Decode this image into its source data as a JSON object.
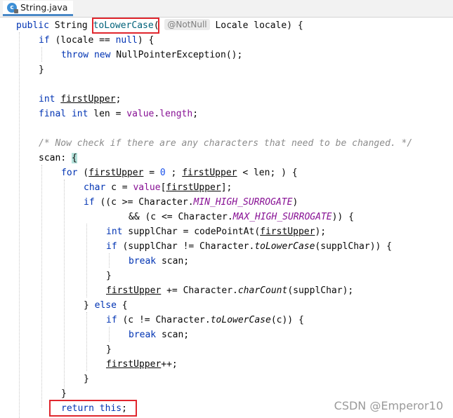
{
  "tab": {
    "title": "String.java",
    "icon": "java-class-icon",
    "icon_letter": "c"
  },
  "code": {
    "l1": {
      "public": "public",
      "type": "String",
      "method": "toLowerCase",
      "paren": "(",
      "annotation": "@NotNull",
      "param": "Locale locale) {"
    },
    "l2": {
      "if": "if",
      "rest_a": " (locale == ",
      "null": "null",
      "rest_b": ") {"
    },
    "l3": {
      "throw": "throw",
      "new": "new",
      "rest": " NullPointerException();"
    },
    "l4": {
      "close": "}"
    },
    "l6": {
      "int": "int",
      "var": "firstUpper",
      "semi": ";"
    },
    "l7": {
      "final": "final",
      "int": "int",
      "rest_a": " len = ",
      "value": "value",
      "dot": ".",
      "length": "length",
      "semi": ";"
    },
    "l9": {
      "comment": "/* Now check if there are any characters that need to be changed. */"
    },
    "l10": {
      "label": "scan",
      "colon": ": ",
      "brace": "{"
    },
    "l11": {
      "for": "for",
      "p1": " (",
      "v1": "firstUpper",
      "p2": " = ",
      "zero": "0",
      "p3": " ; ",
      "v2": "firstUpper",
      "p4": " < len; ) {"
    },
    "l12": {
      "char": "char",
      "p1": " c = ",
      "value": "value",
      "p2": "[",
      "v": "firstUpper",
      "p3": "];"
    },
    "l13": {
      "if": "if",
      "p1": " ((c >= Character.",
      "const": "MIN_HIGH_SURROGATE",
      "p2": ")"
    },
    "l14": {
      "p1": "&& (c <= Character.",
      "const": "MAX_HIGH_SURROGATE",
      "p2": ")) {"
    },
    "l15": {
      "int": "int",
      "p1": " supplChar = codePointAt(",
      "v": "firstUpper",
      "p2": ");"
    },
    "l16": {
      "if": "if",
      "p1": " (supplChar != Character.",
      "m": "toLowerCase",
      "p2": "(supplChar)) {"
    },
    "l17": {
      "break": "break",
      "p1": " scan;"
    },
    "l18": {
      "close": "}"
    },
    "l19": {
      "v": "firstUpper",
      "p1": " += Character.",
      "m": "charCount",
      "p2": "(supplChar);"
    },
    "l20": {
      "p1": "} ",
      "else": "else",
      "p2": " {"
    },
    "l21": {
      "if": "if",
      "p1": " (c != Character.",
      "m": "toLowerCase",
      "p2": "(c)) {"
    },
    "l22": {
      "break": "break",
      "p1": " scan;"
    },
    "l23": {
      "close": "}"
    },
    "l24": {
      "v": "firstUpper",
      "p1": "++;"
    },
    "l25": {
      "close": "}"
    },
    "l26": {
      "close": "}"
    },
    "l27": {
      "return": "return",
      "this": "this",
      "semi": ";"
    }
  },
  "watermark": "CSDN @Emperor10",
  "colors": {
    "keyword": "#0033b3",
    "field": "#871094",
    "number": "#1750eb",
    "comment": "#8c8c8c",
    "highlight_box": "#e0262d",
    "brace_match": "#b4e1da"
  }
}
